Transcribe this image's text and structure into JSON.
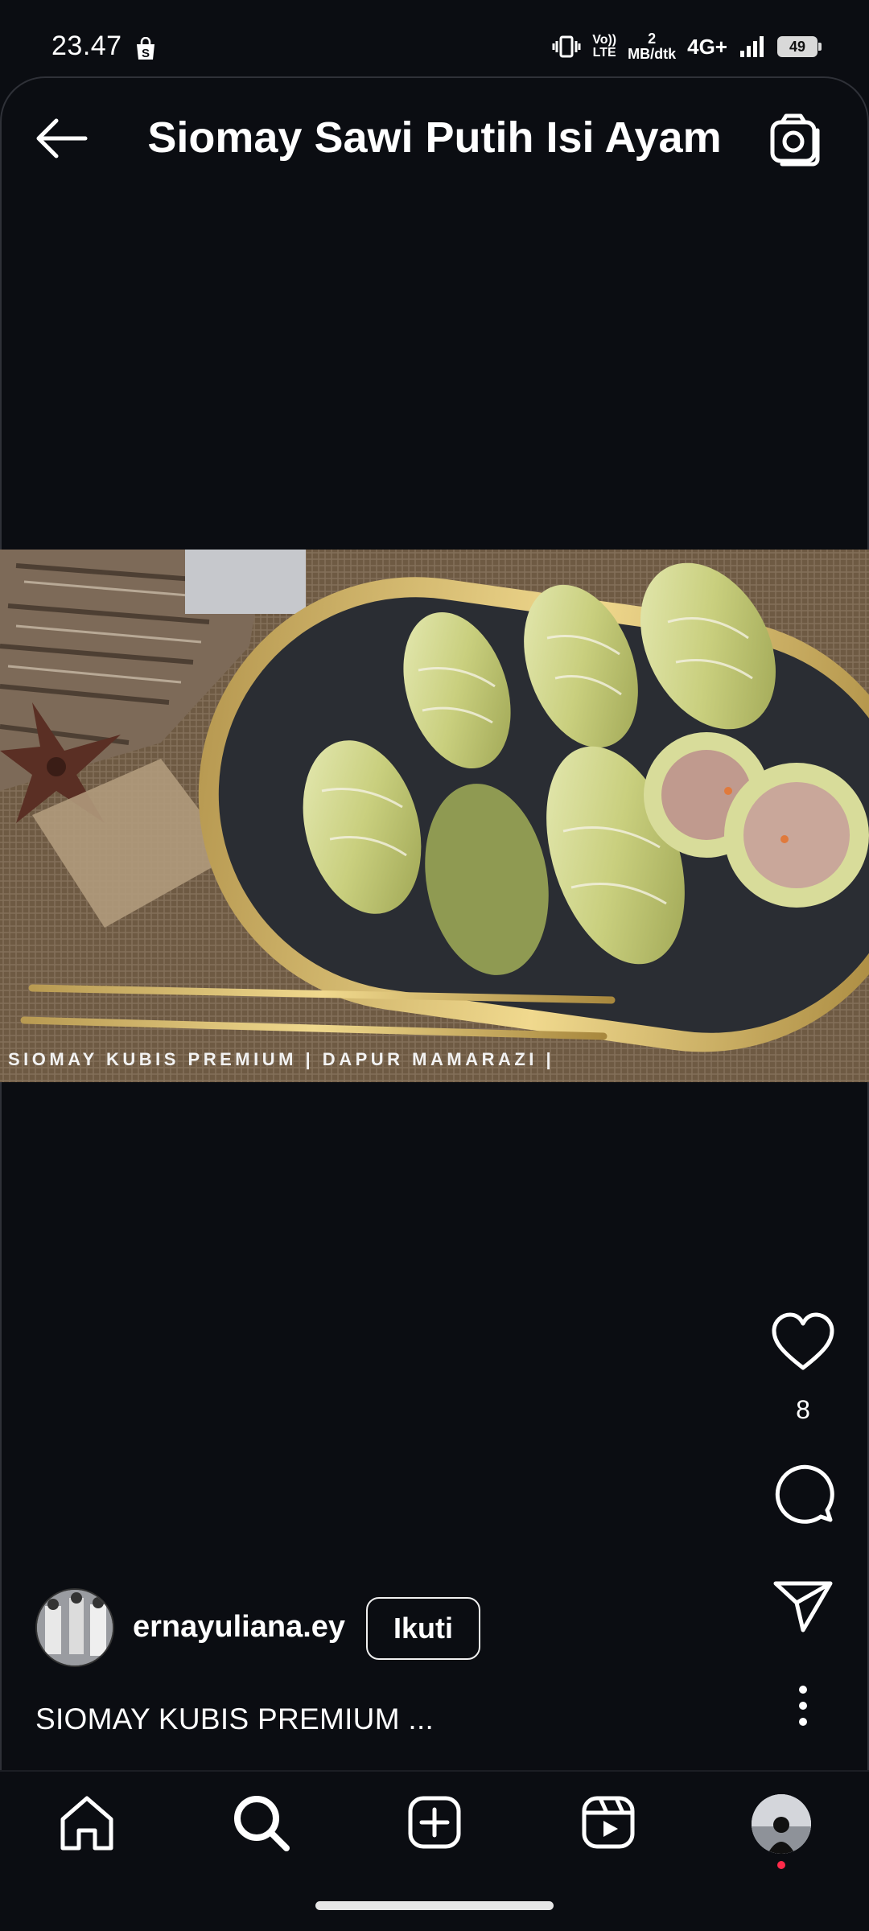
{
  "status_bar": {
    "time": "23.47",
    "shop_icon": "shopping-bag-s-icon",
    "vibrate_icon": "vibrate-icon",
    "volte_top": "Vo))",
    "volte_bottom": "LTE",
    "net_speed_value": "2",
    "net_speed_unit": "MB/dtk",
    "network_type": "4G+",
    "signal_icon": "signal-bars-icon",
    "battery_level": "49"
  },
  "header": {
    "title": "Siomay Sawi Putih Isi Ayam",
    "back_icon": "arrow-left-icon",
    "camera_icon": "camera-icon"
  },
  "post": {
    "photo_watermark": "SIOMAY KUBIS PREMIUM | DAPUR MAMARAZI |",
    "like_icon": "heart-icon",
    "like_count": "8",
    "comment_icon": "comment-bubble-icon",
    "share_icon": "send-paper-plane-icon",
    "more_icon": "more-vertical-icon",
    "author": {
      "username": "ernayuliana.ey",
      "follow_label": "Ikuti"
    },
    "caption": "SIOMAY KUBIS PREMIUM ..."
  },
  "bottom_nav": {
    "items": [
      "home-icon",
      "search-icon",
      "create-plus-icon",
      "reels-icon",
      "profile-avatar"
    ]
  },
  "colors": {
    "background": "#0b0d12",
    "text": "#ffffff",
    "notification_dot": "#ff2a4a"
  }
}
